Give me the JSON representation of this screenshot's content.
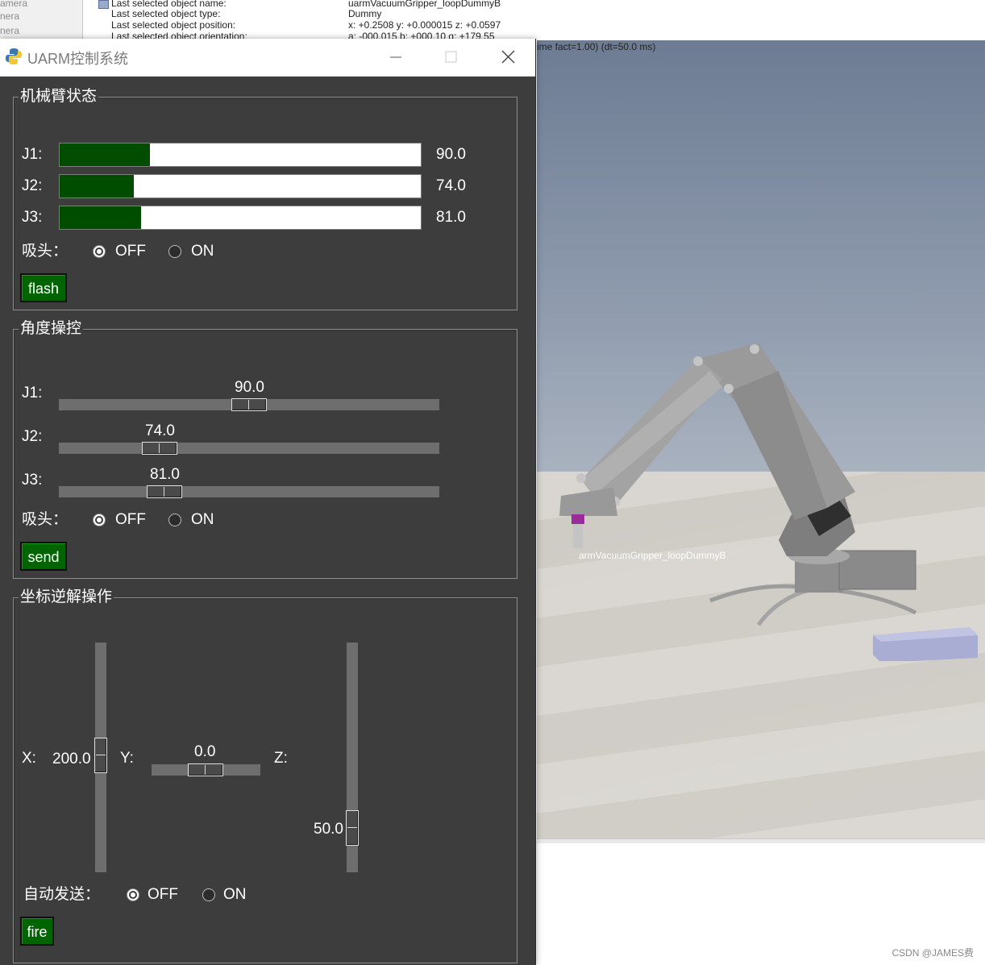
{
  "sim": {
    "left_items": [
      "amera",
      "nera",
      "nera"
    ],
    "info_rows": [
      {
        "key": "Last selected object name:",
        "value": "uarmVacuumGripper_loopDummyB"
      },
      {
        "key": "Last selected object type:",
        "value": "Dummy"
      },
      {
        "key": "Last selected object position:",
        "value": "x: +0.2508    y: +0.000015    z: +0.0597"
      },
      {
        "key": "Last selected object orientation:",
        "value": "a: -000.015    b: +000.10    g: +179.55"
      }
    ],
    "time_fact": "ime fact=1.00) (dt=50.0 ms)",
    "object_label": "armVacuumGripper_loopDummyB",
    "watermark": "CSDN @JAMES费"
  },
  "window": {
    "title": "UARM控制系统",
    "icon": "python-icon"
  },
  "status_group": {
    "title": "机械臂状态",
    "joints": [
      {
        "label": "J1:",
        "value": "90.0",
        "fraction": 0.25
      },
      {
        "label": "J2:",
        "value": "74.0",
        "fraction": 0.205
      },
      {
        "label": "J3:",
        "value": "81.0",
        "fraction": 0.225
      }
    ],
    "suction_label": "吸头：",
    "off_label": "OFF",
    "on_label": "ON",
    "selected": "OFF",
    "button_label": "flash"
  },
  "angle_group": {
    "title": "角度操控",
    "sliders": [
      {
        "label": "J1:",
        "value": "90.0",
        "fraction": 0.5
      },
      {
        "label": "J2:",
        "value": "74.0",
        "fraction": 0.24
      },
      {
        "label": "J3:",
        "value": "81.0",
        "fraction": 0.255
      }
    ],
    "suction_label": "吸头：",
    "off_label": "OFF",
    "on_label": "ON",
    "selected": "OFF",
    "button_label": "send"
  },
  "ik_group": {
    "title": "坐标逆解操作",
    "x_label": "X:",
    "x_value": "200.0",
    "y_label": "Y:",
    "y_value": "0.0",
    "z_label": "Z:",
    "z_value": "50.0",
    "auto_label": "自动发送：",
    "off_label": "OFF",
    "on_label": "ON",
    "selected": "OFF",
    "button_label": "fire"
  }
}
